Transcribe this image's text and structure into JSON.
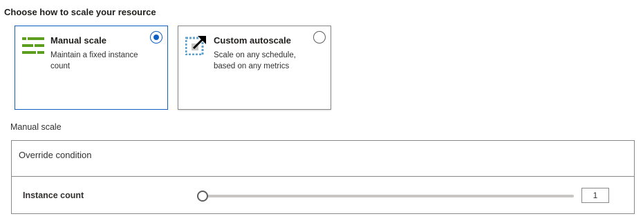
{
  "heading": "Choose how to scale your resource",
  "options": [
    {
      "title": "Manual scale",
      "description": "Maintain a fixed instance count",
      "icon": "manual-scale-icon",
      "selected": true
    },
    {
      "title": "Custom autoscale",
      "description": "Scale on any schedule, based on any metrics",
      "icon": "autoscale-icon",
      "selected": false
    }
  ],
  "manual": {
    "section_label": "Manual scale",
    "override_label": "Override condition",
    "instance_label": "Instance count",
    "instance_value": "1",
    "slider_fraction": 0
  },
  "colors": {
    "accent": "#0f5fc2",
    "manual_icon_green": "#5c9e1e",
    "autoscale_icon_blue": "#5ea0ce"
  }
}
